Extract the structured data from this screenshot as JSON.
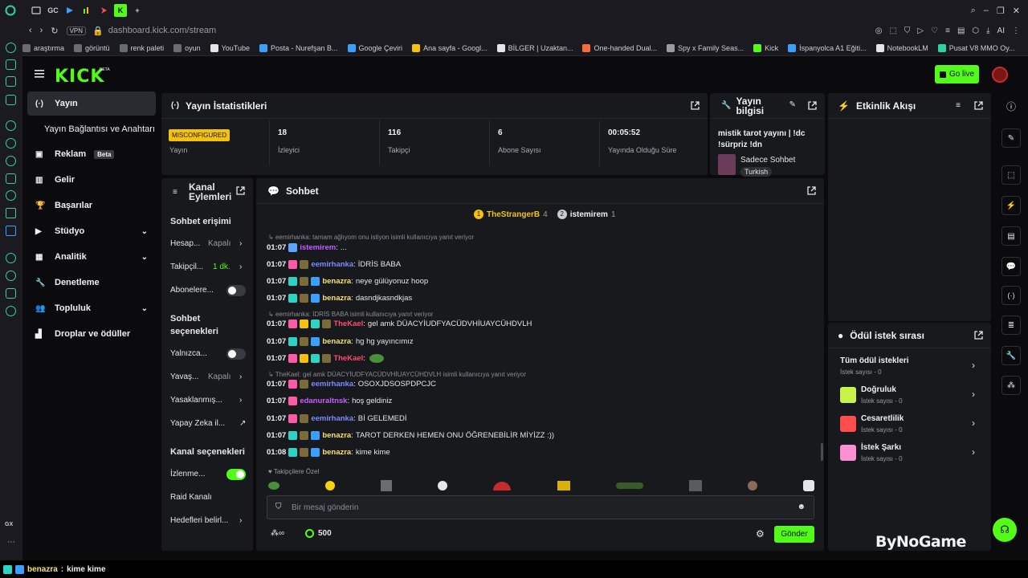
{
  "browser": {
    "tab_icons": [
      "opera-gx-icon",
      "window-icon",
      "GC",
      "play-icon",
      "bars-icon",
      "arrow-icon",
      "kick-tab-icon",
      "plus-icon"
    ],
    "url": "dashboard.kick.com/stream",
    "vpn": "VPN",
    "ai": "AI",
    "bookmarks": [
      "araştırma",
      "görüntü",
      "renk paleti",
      "oyun",
      "YouTube",
      "Posta - Nurefşan B...",
      "Google Çeviri",
      "Ana sayfa - Googl...",
      "BİLGER | Uzaktan...",
      "One-handed Dual...",
      "Spy x Family Seas...",
      "Kick",
      "İspanyolca A1 Eğiti...",
      "NotebookLM",
      "Pusat V8 MMO Oy..."
    ],
    "gx_label": "GX"
  },
  "header": {
    "logo": "KICK",
    "beta": "BETA",
    "go_live": "Go live"
  },
  "sidebar": {
    "items": [
      {
        "label": "Yayın"
      },
      {
        "label": "Yayın Bağlantısı ve Anahtarı"
      },
      {
        "label": "Reklam",
        "badge": "Beta"
      },
      {
        "label": "Gelir"
      },
      {
        "label": "Başarılar"
      },
      {
        "label": "Stüdyo"
      },
      {
        "label": "Analitik"
      },
      {
        "label": "Denetleme"
      },
      {
        "label": "Topluluk"
      },
      {
        "label": "Droplar ve ödüller"
      }
    ]
  },
  "stats": {
    "title": "Yayın İstatistikleri",
    "status": "MISCONFIGURED",
    "status_label": "Yayın",
    "items": [
      {
        "value": "18",
        "label": "İzleyici"
      },
      {
        "value": "116",
        "label": "Takipçi"
      },
      {
        "value": "6",
        "label": "Abone Sayısı"
      },
      {
        "value": "00:05:52",
        "label": "Yayında Olduğu Süre"
      }
    ]
  },
  "info": {
    "title": "Yayın bilgisi",
    "stream_title": "mistik tarot yayını | !dc !sürpriz !dn",
    "category": "Sadece Sohbet",
    "language": "Turkish"
  },
  "activity": {
    "title": "Etkinlik Akışı"
  },
  "channel": {
    "title": "Kanal Eylemleri",
    "sec1": "Sohbet erişimi",
    "rows1": [
      {
        "label": "Hesap...",
        "value": "Kapalı"
      },
      {
        "label": "Takipçil...",
        "value": "1 dk."
      },
      {
        "label": "Abonelere...",
        "value": ""
      }
    ],
    "sec2": "Sohbet seçenekleri",
    "rows2": [
      {
        "label": "Yalnızca...",
        "value": ""
      },
      {
        "label": "Yavaş...",
        "value": "Kapalı"
      },
      {
        "label": "Yasaklanmış...",
        "value": ""
      },
      {
        "label": "Yapay Zeka il...",
        "value": ""
      }
    ],
    "sec3": "Kanal seçenekleri",
    "rows3": [
      {
        "label": "İzlenme..."
      },
      {
        "label": "Raid Kanalı"
      },
      {
        "label": "Hedefleri belirl..."
      }
    ]
  },
  "chat": {
    "title": "Sohbet",
    "top": [
      {
        "rank": "1",
        "name": "TheStrangerB",
        "count": "4"
      },
      {
        "rank": "2",
        "name": "istemirem",
        "count": "1"
      }
    ],
    "messages": [
      {
        "type": "reply",
        "text": "eemirhanka: tamam ağlıyom onu istiyon isimli kullanıcıya yanıt veriyor"
      },
      {
        "time": "01:07",
        "user": "istemirem",
        "color": "#c95cff",
        "text": "...",
        "badges": [
          "#5aa5ff"
        ]
      },
      {
        "time": "01:07",
        "user": "eemirhanka",
        "color": "#7b8bff",
        "text": "İDRİS BABA",
        "badges": [
          "#ff5aa6",
          "#7a6b3a"
        ]
      },
      {
        "time": "01:07",
        "user": "benazra",
        "color": "#f7e36b",
        "text": "neye gülüyonuz hoop",
        "badges": [
          "#2dd4c4",
          "#7a6b3a",
          "#3aa0ff"
        ]
      },
      {
        "time": "01:07",
        "user": "benazra",
        "color": "#f7e36b",
        "text": "dasndjkasndkjas",
        "badges": [
          "#2dd4c4",
          "#7a6b3a",
          "#3aa0ff"
        ]
      },
      {
        "type": "reply",
        "text": "eemirhanka: İDRİS BABA isimli kullanıcıya yanıt veriyor"
      },
      {
        "time": "01:07",
        "user": "TheKael",
        "color": "#ff4d6d",
        "text": "gel amk DÜACYİUDFYACÜDVHİUAYCÜHDVLH",
        "badges": [
          "#ff5aa6",
          "#f4c20d",
          "#2dd4c4",
          "#7a6b3a"
        ]
      },
      {
        "time": "01:07",
        "user": "benazra",
        "color": "#f7e36b",
        "text": "hg hg yayıncımız",
        "badges": [
          "#2dd4c4",
          "#7a6b3a",
          "#3aa0ff"
        ]
      },
      {
        "time": "01:07",
        "user": "TheKael",
        "color": "#ff4d6d",
        "text": "",
        "badges": [
          "#ff5aa6",
          "#f4c20d",
          "#2dd4c4",
          "#7a6b3a"
        ]
      },
      {
        "type": "reply",
        "text": "TheKael: gel amk DÜACYİUDFYACÜDVHİUAYCÜHDVLH isimli kullanıcıya yanıt veriyor"
      },
      {
        "time": "01:07",
        "user": "eemirhanka",
        "color": "#7b8bff",
        "text": "OSOXJDSOSPDPCJC",
        "badges": [
          "#ff5aa6",
          "#7a6b3a"
        ]
      },
      {
        "time": "01:07",
        "user": "edanuraltnsk",
        "color": "#c95cff",
        "text": "hoş geldiniz",
        "badges": [
          "#ff5aa6"
        ]
      },
      {
        "time": "01:07",
        "user": "eemirhanka",
        "color": "#7b8bff",
        "text": "Bİ GELEMEDİ",
        "badges": [
          "#ff5aa6",
          "#7a6b3a"
        ]
      },
      {
        "time": "01:07",
        "user": "benazra",
        "color": "#f7e36b",
        "text": "TAROT DERKEN HEMEN ONU ÖĞRENEBİLİR MİYİZZ :))",
        "badges": [
          "#2dd4c4",
          "#7a6b3a",
          "#3aa0ff"
        ]
      },
      {
        "time": "01:08",
        "user": "benazra",
        "color": "#f7e36b",
        "text": "kime kime",
        "badges": [
          "#2dd4c4",
          "#7a6b3a",
          "#3aa0ff"
        ]
      }
    ],
    "followers_only": "Takipçilere Özel",
    "placeholder": "Bir mesaj gönderin",
    "points": "500",
    "send": "Gönder"
  },
  "rewards": {
    "title": "Ödül istek sırası",
    "items": [
      {
        "name": "Tüm ödül istekleri",
        "sub": "İstek sayısı - 0",
        "color": ""
      },
      {
        "name": "Doğruluk",
        "sub": "İstek sayısı - 0",
        "color": "#c6f24a"
      },
      {
        "name": "Cesaretlilik",
        "sub": "İstek sayısı - 0",
        "color": "#ff4d4d"
      },
      {
        "name": "İstek Şarkı",
        "sub": "İstek sayısı - 0",
        "color": "#ff8fd0"
      }
    ]
  },
  "watermark": "ByNoGame",
  "status_bar": {
    "user": "benazra",
    "text": "kime kime"
  }
}
